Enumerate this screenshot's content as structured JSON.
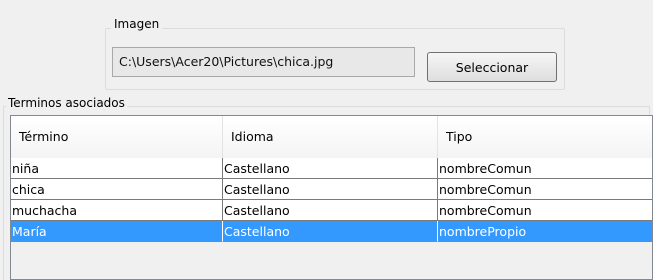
{
  "imagen": {
    "legend": "Imagen",
    "path_value": "C:\\Users\\Acer20\\Pictures\\chica.jpg",
    "select_button_label": "Seleccionar"
  },
  "terminos": {
    "legend": "Terminos asociados",
    "columns": [
      "Término",
      "Idioma",
      "Tipo"
    ],
    "rows": [
      {
        "termino": "niña",
        "idioma": "Castellano",
        "tipo": "nombreComun"
      },
      {
        "termino": "chica",
        "idioma": "Castellano",
        "tipo": "nombreComun"
      },
      {
        "termino": "muchacha",
        "idioma": "Castellano",
        "tipo": "nombreComun"
      },
      {
        "termino": "María",
        "idioma": "Castellano",
        "tipo": "nombrePropio"
      }
    ],
    "selected_row_index": 3,
    "selection_color": "#3399ff"
  }
}
